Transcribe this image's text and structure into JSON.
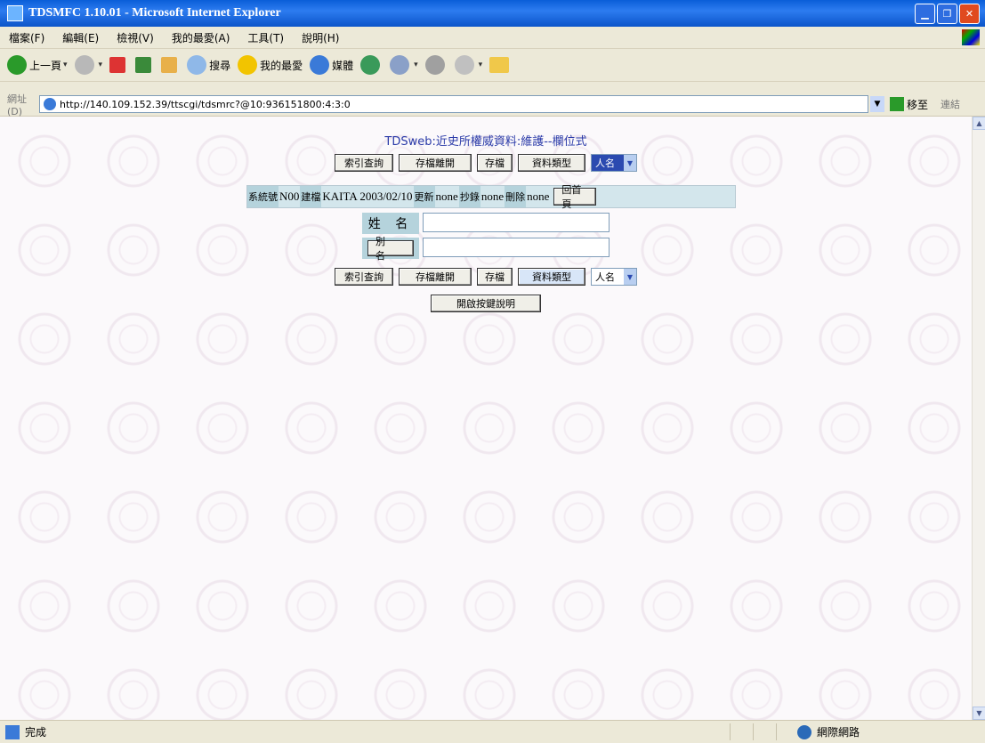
{
  "window": {
    "title": "TDSMFC 1.10.01 - Microsoft Internet Explorer"
  },
  "menu": [
    "檔案(F)",
    "編輯(E)",
    "檢視(V)",
    "我的最愛(A)",
    "工具(T)",
    "說明(H)"
  ],
  "toolbar": {
    "back_label": "上一頁",
    "search_label": "搜尋",
    "favorites_label": "我的最愛",
    "media_label": "媒體"
  },
  "address": {
    "label": "網址(D)",
    "url": "http://140.109.152.39/ttscgi/tdsmrc?@10:936151800:4:3:0",
    "go_label": "移至",
    "links_label": "連結"
  },
  "page": {
    "title": "TDSweb:近史所權威資料:維護--欄位式",
    "buttons": {
      "index_query": "索引查詢",
      "save_leave": "存檔離開",
      "save": "存檔",
      "data_type": "資料類型",
      "type_select_value": "人名",
      "help": "開啟按鍵說明"
    },
    "info": {
      "system_no_label": "系統號",
      "system_no": "N00",
      "created_label": "建檔",
      "created": "KAITA 2003/02/10",
      "updated_label": "更新",
      "updated": "none",
      "copied_label": "抄錄",
      "copied": "none",
      "deleted_label": "刪除",
      "deleted": "none",
      "home_button": "回首頁"
    },
    "fields": {
      "name_label": "姓 名",
      "name_value": "",
      "alias_label": "別 名",
      "alias_value": ""
    }
  },
  "status": {
    "left": "完成",
    "right": "網際網路"
  }
}
